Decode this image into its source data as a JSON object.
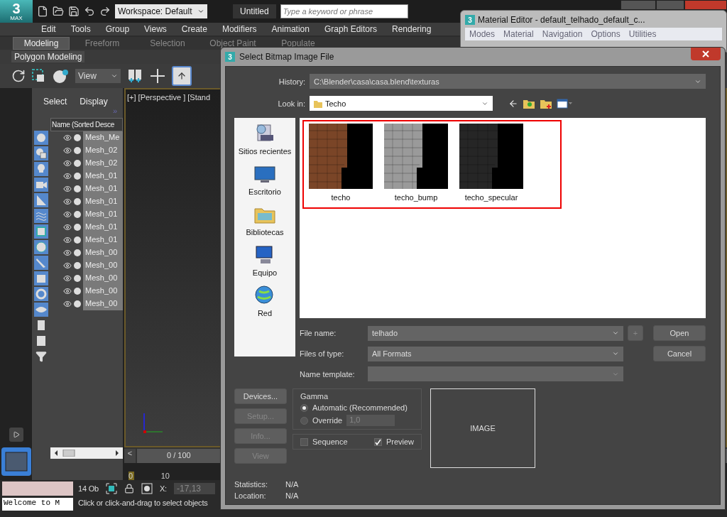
{
  "app": {
    "logo": "3",
    "logo_sub": "MAX",
    "workspace": "Workspace: Default",
    "document": "Untitled",
    "search": {
      "placeholder": "Type a keyword or phrase"
    },
    "menu": [
      "Edit",
      "Tools",
      "Group",
      "Views",
      "Create",
      "Modifiers",
      "Animation",
      "Graph Editors",
      "Rendering"
    ],
    "ribbon_tabs": [
      {
        "label": "Modeling",
        "selected": true
      },
      {
        "label": "Freeform",
        "selected": false
      },
      {
        "label": "Selection",
        "selected": false
      },
      {
        "label": "Object Paint",
        "selected": false
      },
      {
        "label": "Populate",
        "selected": false
      }
    ],
    "ribbon_panel": "Polygon Modeling",
    "view_dropdown": "View",
    "explorer": {
      "tabs": [
        "Select",
        "Display"
      ],
      "more": "»",
      "column": "Name (Sorted Desce",
      "rows": [
        {
          "name": "Mesh_Me",
          "selected": true
        },
        {
          "name": "Mesh_02",
          "selected": true
        },
        {
          "name": "Mesh_02",
          "selected": true
        },
        {
          "name": "Mesh_01",
          "selected": true
        },
        {
          "name": "Mesh_01",
          "selected": true
        },
        {
          "name": "Mesh_01",
          "selected": true
        },
        {
          "name": "Mesh_01",
          "selected": true
        },
        {
          "name": "Mesh_01",
          "selected": true
        },
        {
          "name": "Mesh_01",
          "selected": true
        },
        {
          "name": "Mesh_00",
          "selected": true
        },
        {
          "name": "Mesh_00",
          "selected": true
        },
        {
          "name": "Mesh_00",
          "selected": true
        },
        {
          "name": "Mesh_00",
          "selected": true
        },
        {
          "name": "Mesh_00",
          "selected": true
        }
      ]
    },
    "viewport_label": "[+] [Perspective ] [Stand",
    "timeline": {
      "prev": "<",
      "frame": "0 / 100",
      "ticks": [
        "0",
        "10"
      ]
    },
    "status": {
      "count": "14 Ob",
      "x_label": "X:",
      "x_value": "-17,13",
      "prompt": "Click or click-and-drag to select objects",
      "listener": "Welcome to M"
    }
  },
  "material_editor": {
    "logo": "3",
    "title": "Material Editor - default_telhado_default_c...",
    "menu": [
      "Modes",
      "Material",
      "Navigation",
      "Options",
      "Utilities"
    ]
  },
  "dialog": {
    "logo": "3",
    "title": "Select Bitmap Image File",
    "history_label": "History:",
    "history": "C:\\Blender\\casa\\casa.blend\\texturas",
    "look_in_label": "Look in:",
    "look_in": "Techo",
    "places": [
      "Sitios recientes",
      "Escritorio",
      "Bibliotecas",
      "Equipo",
      "Red"
    ],
    "files": [
      {
        "name": "techo",
        "kind": "diffuse"
      },
      {
        "name": "techo_bump",
        "kind": "bump"
      },
      {
        "name": "techo_specular",
        "kind": "specular"
      }
    ],
    "file_name_label": "File name:",
    "file_name": "telhado",
    "files_of_type_label": "Files of type:",
    "files_of_type": "All Formats",
    "name_template_label": "Name template:",
    "add": "+",
    "open": "Open",
    "cancel": "Cancel",
    "side_buttons": [
      {
        "label": "Devices...",
        "disabled": false
      },
      {
        "label": "Setup...",
        "disabled": true
      },
      {
        "label": "Info...",
        "disabled": true
      },
      {
        "label": "View",
        "disabled": true
      }
    ],
    "gamma": {
      "title": "Gamma",
      "options": [
        {
          "label": "Automatic (Recommended)",
          "selected": true
        },
        {
          "label": "Override",
          "selected": false
        }
      ],
      "override_value": "1,0"
    },
    "sequence": {
      "label": "Sequence",
      "checked": false
    },
    "preview": {
      "label": "Preview",
      "checked": true
    },
    "image": "IMAGE",
    "statistics_label": "Statistics:",
    "statistics": "N/A",
    "location_label": "Location:",
    "location": "N/A"
  }
}
